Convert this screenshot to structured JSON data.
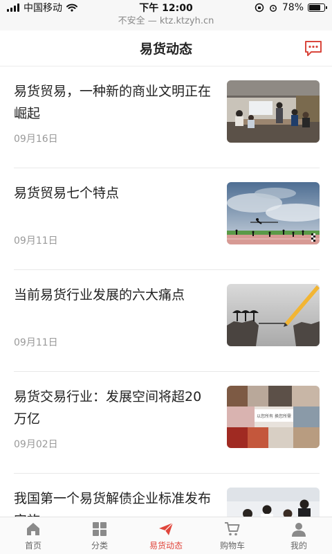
{
  "status_bar": {
    "carrier": "中国移动",
    "time": "下午 12:00",
    "battery": "78%",
    "battery_level": 0.78
  },
  "url_bar": {
    "text": "不安全 — ktz.ktzyh.cn"
  },
  "header": {
    "title": "易货动态",
    "message_icon": "chat-bubble-icon"
  },
  "articles": [
    {
      "title": "易货贸易，一种新的商业文明正在崛起",
      "date": "09月16日",
      "thumbnail": "business-meeting-photo"
    },
    {
      "title": "易货贸易七个特点",
      "date": "09月11日",
      "thumbnail": "high-jump-runners-photo"
    },
    {
      "title": "当前易货行业发展的六大痛点",
      "date": "09月11日",
      "thumbnail": "pencil-bridge-cliff-photo"
    },
    {
      "title": "易货交易行业：发展空间将超20万亿",
      "date": "09月02日",
      "thumbnail": "collage-photo"
    },
    {
      "title": "我国第一个易货解债企业标准发布实施",
      "date": "",
      "thumbnail": "office-team-photo"
    }
  ],
  "thumb_captions": {
    "collage_banner": "以您所有 换您所需"
  },
  "tabbar": {
    "tabs": [
      {
        "label": "首页",
        "icon": "home-icon"
      },
      {
        "label": "分类",
        "icon": "grid-icon"
      },
      {
        "label": "易货动态",
        "icon": "paper-plane-icon",
        "active": true
      },
      {
        "label": "购物车",
        "icon": "cart-icon"
      },
      {
        "label": "我的",
        "icon": "user-icon"
      }
    ]
  },
  "colors": {
    "accent": "#e0463c",
    "text": "#222222",
    "muted": "#999999"
  }
}
